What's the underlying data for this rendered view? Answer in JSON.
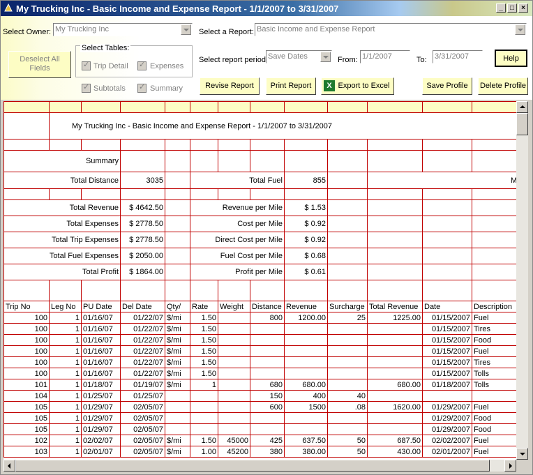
{
  "window": {
    "title": "My Trucking Inc - Basic Income and Expense Report - 1/1/2007 to 3/31/2007"
  },
  "controls": {
    "owner_label": "Select Owner:",
    "owner_value": "My Trucking Inc",
    "report_label": "Select a Report:",
    "report_value": "Basic Income and Expense Report",
    "deselect_label": "Deselect All Fields",
    "tables_label": "Select Tables:",
    "trip_detail": "Trip Detail",
    "expenses": "Expenses",
    "subtotals": "Subtotals",
    "summary": "Summary",
    "period_label": "Select report period:",
    "period_value": "Save Dates",
    "from_label": "From:",
    "from_value": "1/1/2007",
    "to_label": "To:",
    "to_value": "3/31/2007",
    "help": "Help",
    "revise": "Revise Report",
    "print": "Print Report",
    "excel": "Export to Excel",
    "save_profile": "Save Profile",
    "delete_profile": "Delete Profile"
  },
  "report": {
    "title": "My Trucking Inc - Basic Income and Expense Report - 1/1/2007 to 3/31/2007",
    "summary_title": "Summary",
    "total_distance_label": "Total Distance",
    "total_distance": "3035",
    "total_fuel_label": "Total Fuel",
    "total_fuel": "855",
    "mpg_label": "MPG",
    "rows": [
      {
        "l1": "Total Revenue",
        "v1": "$ 4642.50",
        "l2": "Revenue per Mile",
        "v2": "$ 1.53"
      },
      {
        "l1": "Total Expenses",
        "v1": "$ 2778.50",
        "l2": "Cost per Mile",
        "v2": "$ 0.92"
      },
      {
        "l1": "Total Trip Expenses",
        "v1": "$ 2778.50",
        "l2": "Direct Cost per Mile",
        "v2": "$ 0.92"
      },
      {
        "l1": "Total Fuel Expenses",
        "v1": "$ 2050.00",
        "l2": "Fuel Cost per Mile",
        "v2": "$ 0.68"
      },
      {
        "l1": "Total Profit",
        "v1": "$ 1864.00",
        "l2": "Profit per Mile",
        "v2": "$ 0.61"
      }
    ],
    "columns": [
      "Trip No",
      "Leg No",
      "PU Date",
      "Del Date",
      "Qty/",
      "Rate",
      "Weight",
      "Distance",
      "Revenue",
      "Surcharge",
      "Total Revenue",
      "Date",
      "Description"
    ],
    "data": [
      [
        "100",
        "1",
        "01/16/07",
        "01/22/07",
        "$/mi",
        "1.50",
        "",
        "800",
        "1200.00",
        "25",
        "1225.00",
        "01/15/2007",
        "Fuel"
      ],
      [
        "100",
        "1",
        "01/16/07",
        "01/22/07",
        "$/mi",
        "1.50",
        "",
        "",
        "",
        "",
        "",
        "01/15/2007",
        "Tires"
      ],
      [
        "100",
        "1",
        "01/16/07",
        "01/22/07",
        "$/mi",
        "1.50",
        "",
        "",
        "",
        "",
        "",
        "01/15/2007",
        "Food"
      ],
      [
        "100",
        "1",
        "01/16/07",
        "01/22/07",
        "$/mi",
        "1.50",
        "",
        "",
        "",
        "",
        "",
        "01/15/2007",
        "Fuel"
      ],
      [
        "100",
        "1",
        "01/16/07",
        "01/22/07",
        "$/mi",
        "1.50",
        "",
        "",
        "",
        "",
        "",
        "01/15/2007",
        "Tires"
      ],
      [
        "100",
        "1",
        "01/16/07",
        "01/22/07",
        "$/mi",
        "1.50",
        "",
        "",
        "",
        "",
        "",
        "01/15/2007",
        "Tolls"
      ],
      [
        "101",
        "1",
        "01/18/07",
        "01/19/07",
        "$/mi",
        "1",
        "",
        "680",
        "680.00",
        "",
        "680.00",
        "01/18/2007",
        "Tolls"
      ],
      [
        "104",
        "1",
        "01/25/07",
        "01/25/07",
        "",
        "",
        "",
        "150",
        "400",
        "40",
        "",
        "",
        ""
      ],
      [
        "105",
        "1",
        "01/29/07",
        "02/05/07",
        "",
        "",
        "",
        "600",
        "1500",
        ".08",
        "1620.00",
        "01/29/2007",
        "Fuel"
      ],
      [
        "105",
        "1",
        "01/29/07",
        "02/05/07",
        "",
        "",
        "",
        "",
        "",
        "",
        "",
        "01/29/2007",
        "Food"
      ],
      [
        "105",
        "1",
        "01/29/07",
        "02/05/07",
        "",
        "",
        "",
        "",
        "",
        "",
        "",
        "01/29/2007",
        "Food"
      ],
      [
        "102",
        "1",
        "02/02/07",
        "02/05/07",
        "$/mi",
        "1.50",
        "45000",
        "425",
        "637.50",
        "50",
        "687.50",
        "02/02/2007",
        "Fuel"
      ],
      [
        "103",
        "1",
        "02/01/07",
        "02/05/07",
        "$/mi",
        "1.00",
        "45200",
        "380",
        "380.00",
        "50",
        "430.00",
        "02/01/2007",
        "Fuel"
      ]
    ]
  }
}
